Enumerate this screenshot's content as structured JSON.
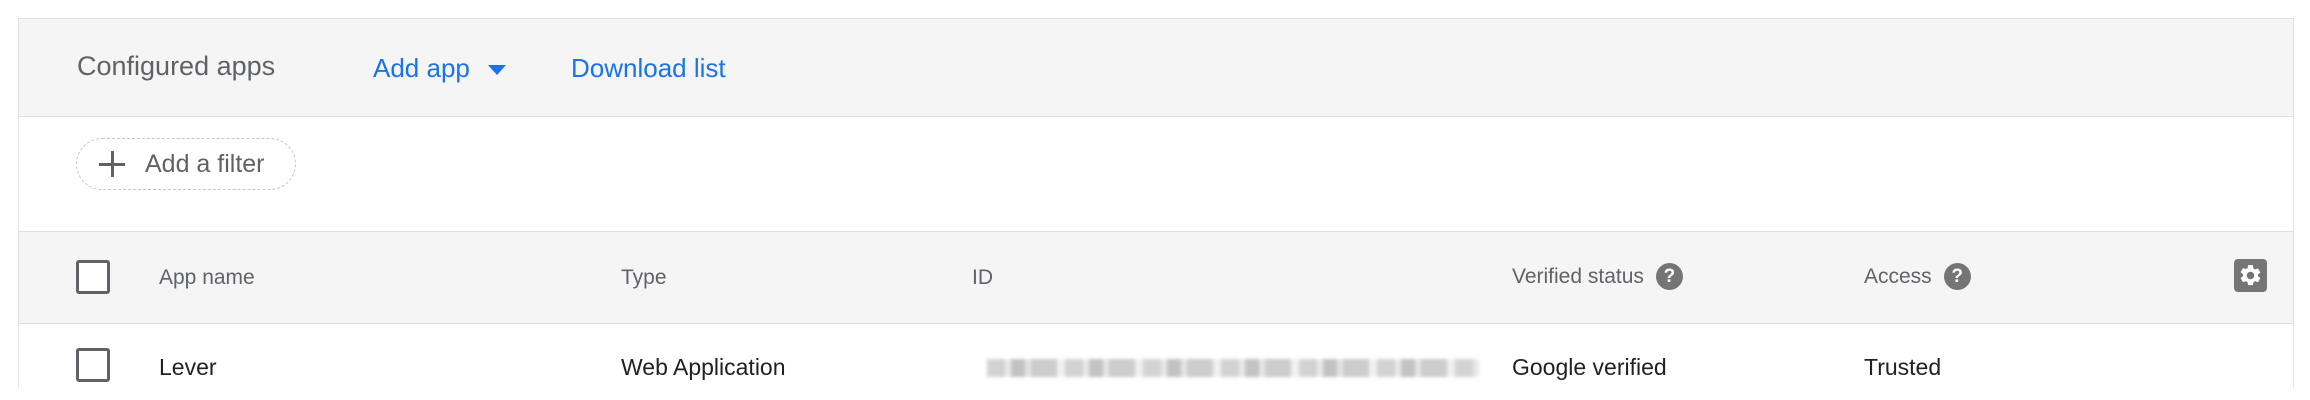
{
  "header": {
    "title": "Configured apps",
    "add_app_label": "Add app",
    "download_label": "Download list"
  },
  "filter": {
    "add_filter_label": "Add a filter"
  },
  "table": {
    "columns": [
      "App name",
      "Type",
      "ID",
      "Verified status",
      "Access"
    ],
    "rows": [
      {
        "app_name": "Lever",
        "type": "Web Application",
        "id": "",
        "verified_status": "Google verified",
        "access": "Trusted"
      }
    ]
  },
  "icons": {
    "add_app_caret": "caret-down-icon",
    "add_filter": "plus-icon",
    "help": "help-icon",
    "settings": "gear-icon"
  },
  "colors": {
    "accent": "#1a73e8",
    "header_bg": "#f5f5f5",
    "text_muted": "#5f6368"
  }
}
